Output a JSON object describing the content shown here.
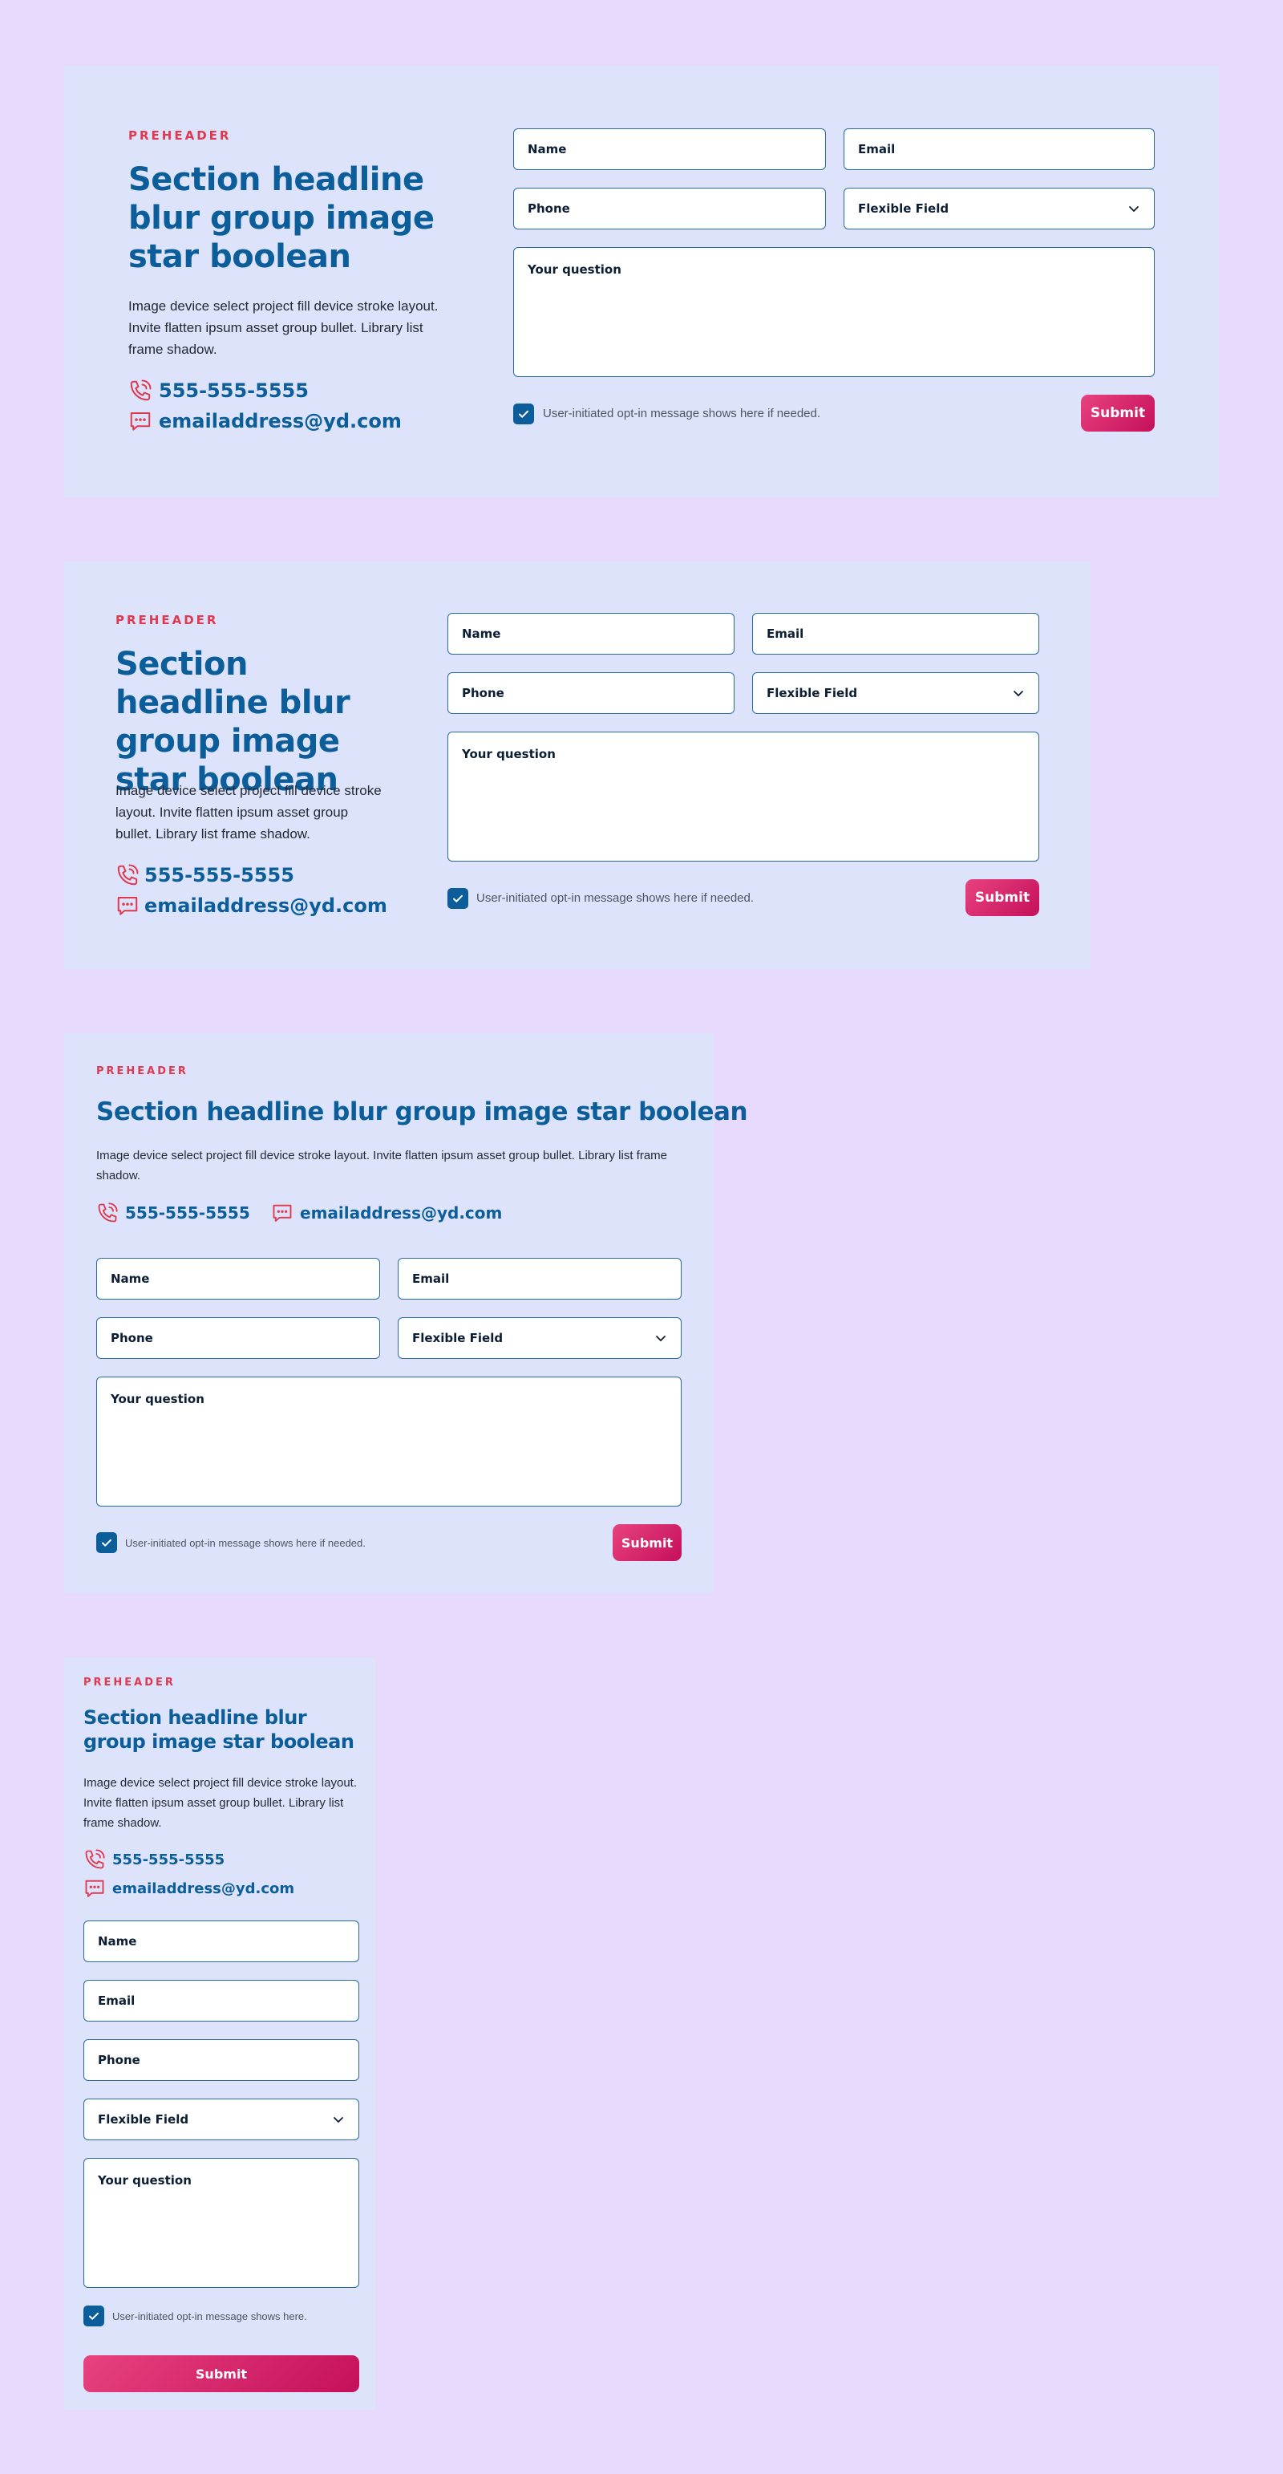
{
  "content": {
    "preheader": "PREHEADER",
    "headline": "Section headline blur group image star boolean",
    "body": "Image device select project fill device stroke layout. Invite flatten ipsum asset group bullet. Library list frame shadow.",
    "phone": "555-555-5555",
    "email": "emailaddress@yd.com"
  },
  "form": {
    "name_label": "Name",
    "email_label": "Email",
    "phone_label": "Phone",
    "flexible_label": "Flexible Field",
    "question_label": "Your question",
    "optin_text": "User-initiated opt-in message shows here if needed.",
    "optin_text_short": "User-initiated opt-in message shows here.",
    "optin_checked": true,
    "submit_label": "Submit"
  },
  "icons": {
    "phone": "phone-icon",
    "message": "message-icon",
    "checkbox": "checkmark-icon",
    "dropdown": "chevron-down-icon"
  },
  "colors": {
    "page_bg": "#e8dafd",
    "card_bg": "#dde3fa",
    "preheader": "#e0384e",
    "headline": "#0c5e9b",
    "field_border": "#2a6aa4",
    "checkbox": "#0c5e9b",
    "submit_start": "#e8427f",
    "submit_end": "#c5105a"
  }
}
